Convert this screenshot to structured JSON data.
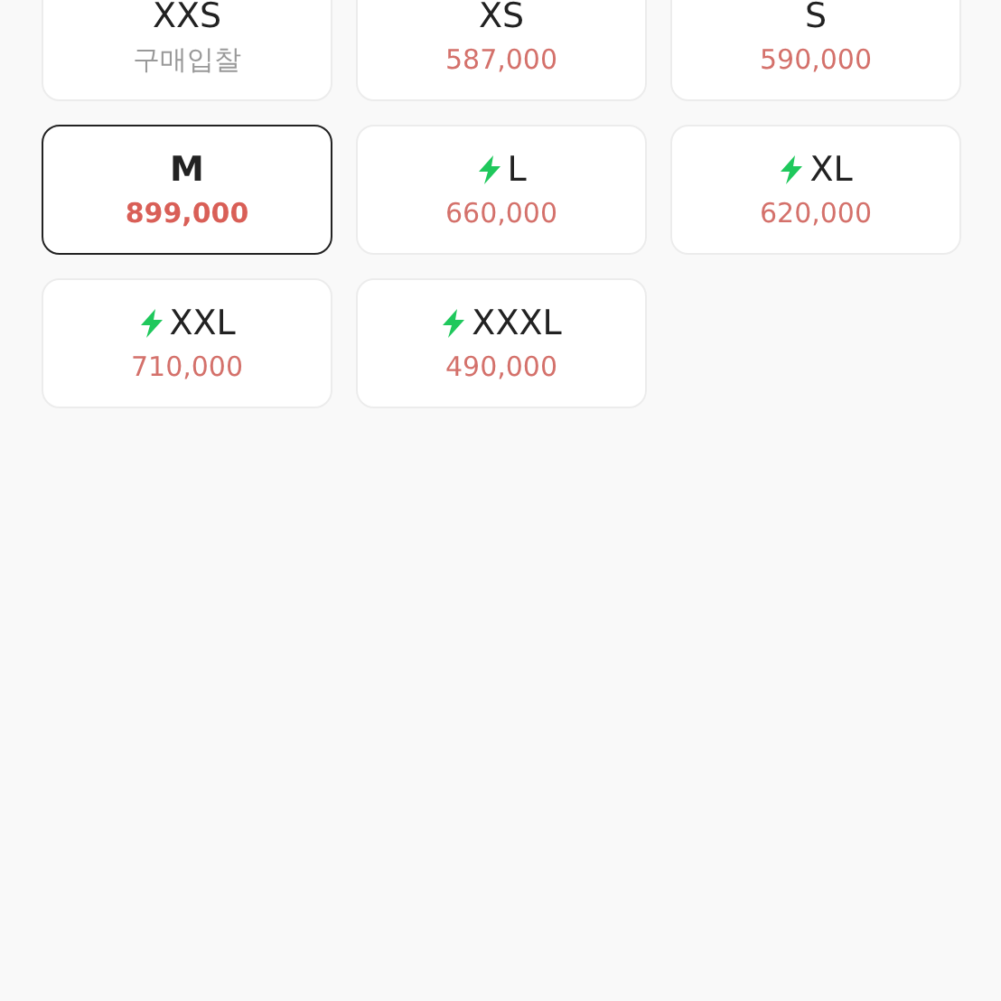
{
  "sizes": [
    {
      "size": "XXS",
      "price": "구매입찰",
      "kind": "bid",
      "express": false,
      "selected": false
    },
    {
      "size": "XS",
      "price": "587,000",
      "kind": "ask",
      "express": false,
      "selected": false
    },
    {
      "size": "S",
      "price": "590,000",
      "kind": "ask",
      "express": false,
      "selected": false
    },
    {
      "size": "M",
      "price": "899,000",
      "kind": "ask",
      "express": false,
      "selected": true
    },
    {
      "size": "L",
      "price": "660,000",
      "kind": "ask",
      "express": true,
      "selected": false
    },
    {
      "size": "XL",
      "price": "620,000",
      "kind": "ask",
      "express": true,
      "selected": false
    },
    {
      "size": "XXL",
      "price": "710,000",
      "kind": "ask",
      "express": true,
      "selected": false
    },
    {
      "size": "XXXL",
      "price": "490,000",
      "kind": "ask",
      "express": true,
      "selected": false
    }
  ]
}
